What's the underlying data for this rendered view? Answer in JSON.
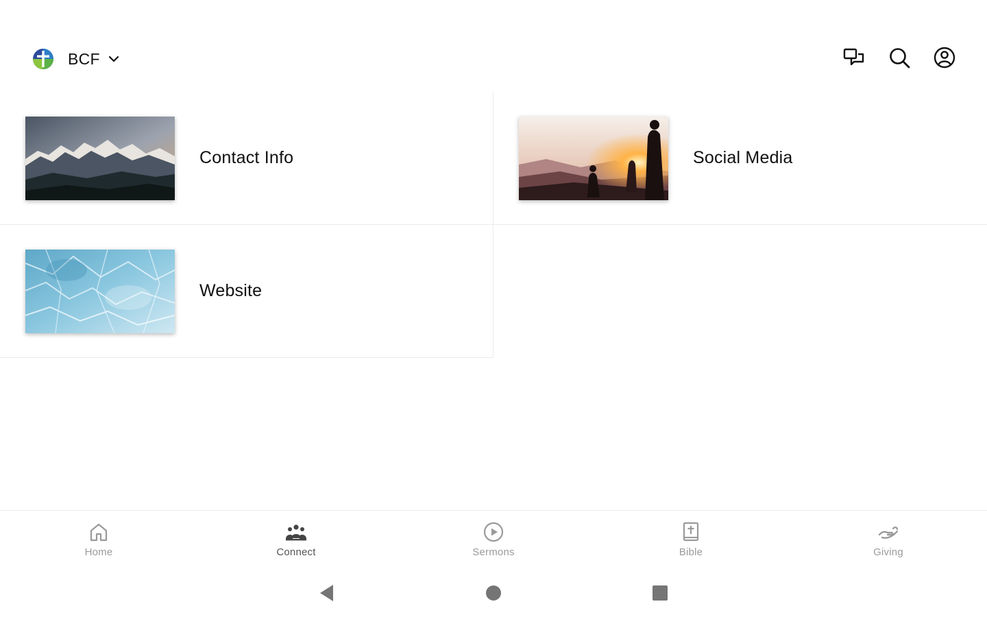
{
  "header": {
    "org_name": "BCF",
    "icons": {
      "logo": "church-logo-icon",
      "switcher": "chevron-down-icon",
      "chat": "chat-icon",
      "search": "search-icon",
      "profile": "user-profile-icon"
    }
  },
  "items": [
    {
      "label": "Contact Info",
      "image": "snowy-mountains-photo"
    },
    {
      "label": "Social Media",
      "image": "sunset-hikers-photo"
    },
    {
      "label": "Website",
      "image": "blue-ice-texture-photo"
    }
  ],
  "bottom_nav": {
    "active": "Connect",
    "items": [
      {
        "label": "Home",
        "icon": "home-icon"
      },
      {
        "label": "Connect",
        "icon": "people-icon"
      },
      {
        "label": "Sermons",
        "icon": "play-circle-icon"
      },
      {
        "label": "Bible",
        "icon": "bible-icon"
      },
      {
        "label": "Giving",
        "icon": "giving-hand-icon"
      }
    ]
  },
  "system_bar": {
    "icons": [
      "back-icon",
      "home-circle-icon",
      "recents-icon"
    ]
  },
  "colors": {
    "text": "#111111",
    "nav_inactive": "#9a9a9a",
    "nav_active": "#555555",
    "divider": "#ececec",
    "logo_blue": "#2b4c9b",
    "logo_green": "#5bb246"
  }
}
